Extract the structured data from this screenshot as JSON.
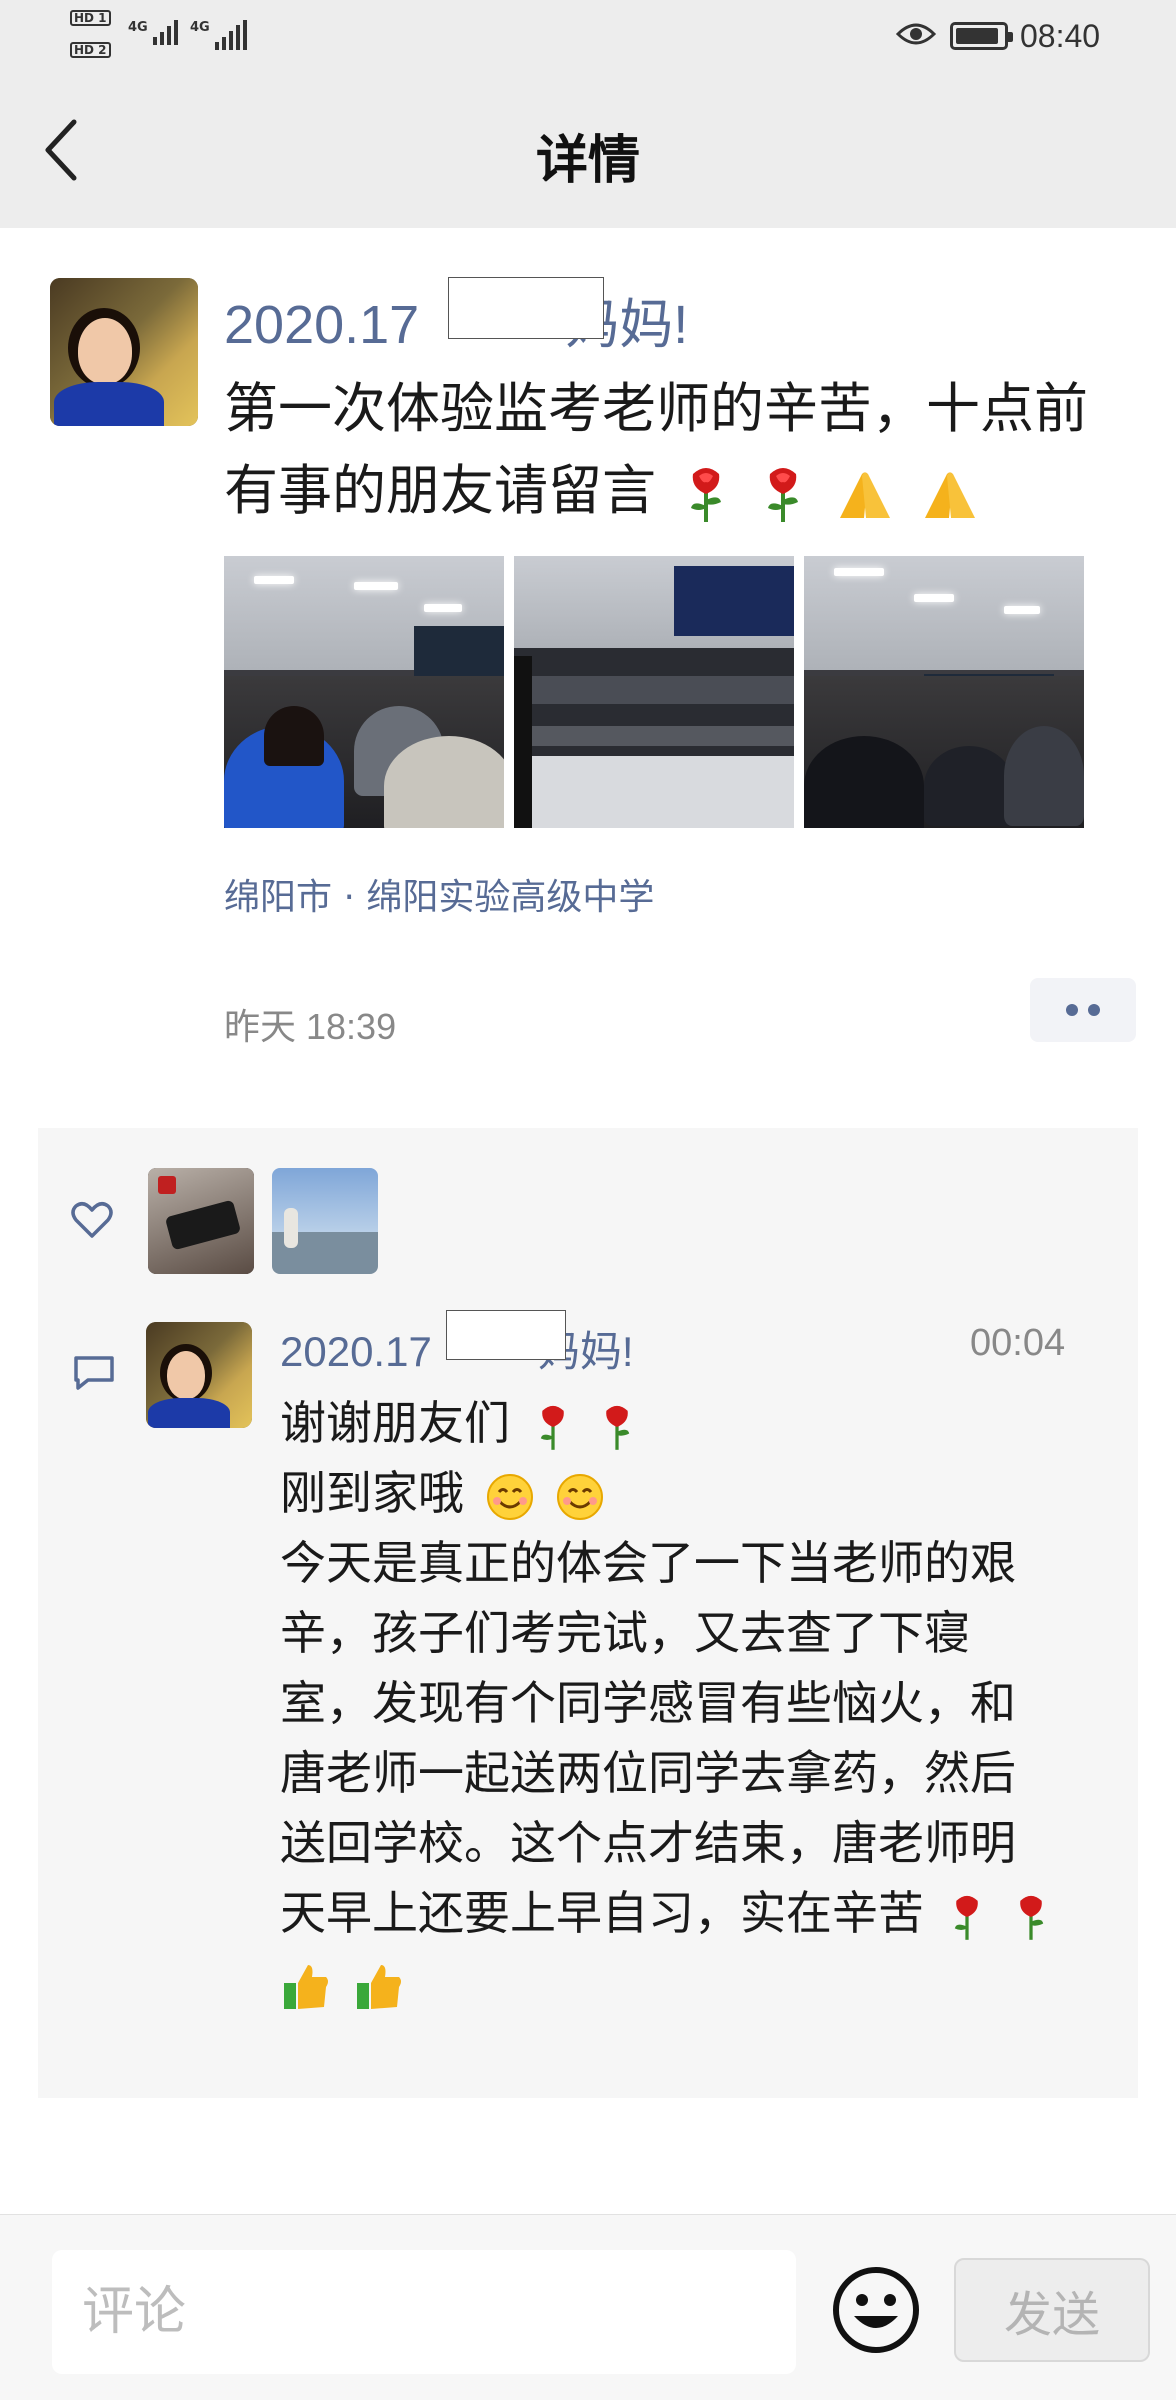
{
  "status_bar": {
    "sim1_label": "HD 1",
    "sim2_label": "HD 2",
    "net1": "4G",
    "net2": "4G",
    "time": "08:40"
  },
  "header": {
    "title": "详情",
    "back_icon": "chevron-left-icon"
  },
  "post": {
    "author_prefix": "2020.17",
    "author_suffix": "妈妈!",
    "text_line1": "第一次体验监考老师的辛苦，十点前",
    "text_line2": "有事的朋友请留言",
    "emojis": [
      "rose-icon",
      "rose-icon",
      "pray-icon",
      "pray-icon"
    ],
    "photos_count": 3,
    "location": "绵阳市 · 绵阳实验高级中学",
    "time": "昨天 18:39",
    "more_icon": "more-dots-icon"
  },
  "likes": {
    "icon": "heart-icon",
    "avatars_count": 2
  },
  "comment": {
    "icon": "comment-icon",
    "author_prefix": "2020.17",
    "author_suffix": "妈妈!",
    "time": "00:04",
    "lines": [
      "谢谢朋友们",
      "刚到家哦",
      "今天是真正的体会了一下当老师的艰",
      "辛，孩子们考完试，又去查了下寝",
      "室，发现有个同学感冒有些恼火，和",
      "唐老师一起送两位同学去拿药，然后",
      "送回学校。这个点才结束，唐老师明",
      "天早上还要上早自习，实在辛苦",
      ""
    ]
  },
  "input_bar": {
    "placeholder": "评论",
    "emoji_icon": "smiley-icon",
    "send_label": "发送"
  },
  "colors": {
    "link": "#576b95",
    "header_bg": "#ededed",
    "panel_bg": "#f6f6f6"
  }
}
